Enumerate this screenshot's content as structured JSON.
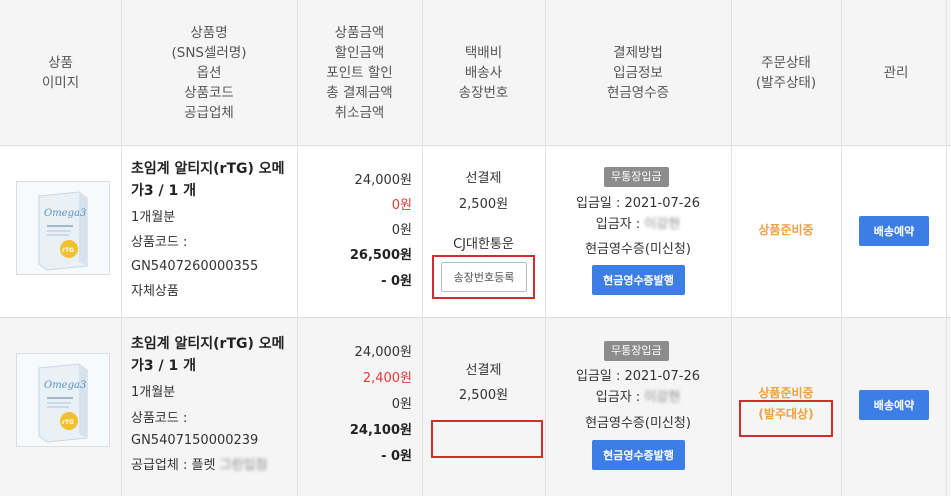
{
  "header": {
    "image": [
      "상품",
      "이미지"
    ],
    "product": [
      "상품명",
      "(SNS셀러명)",
      "옵션",
      "상품코드",
      "공급업체"
    ],
    "amount": [
      "상품금액",
      "할인금액",
      "포인트 할인",
      "총 결제금액",
      "취소금액"
    ],
    "delivery": [
      "택배비",
      "배송사",
      "송장번호"
    ],
    "payment": [
      "결제방법",
      "입금정보",
      "현금영수증"
    ],
    "status": [
      "주문상태",
      "(발주상태)"
    ],
    "manage": [
      "관리"
    ]
  },
  "rows": [
    {
      "name_line1": "초임계 알티지(rTG) 오메",
      "name_line2": "가3 / 1 개",
      "option": "1개월분",
      "code_label": "상품코드 :",
      "code": "GN5407260000355",
      "supplier": "자체상품",
      "price": "24,000원",
      "discount": "0원",
      "point_discount": "0원",
      "total": "26,500원",
      "cancel": "- 0원",
      "shipping_type": "선결제",
      "shipping_fee": "2,500원",
      "carrier": "CJ대한통운",
      "invoice_button": "송장번호등록",
      "pay_badge": "무통장입금",
      "deposit_date": "입금일 : 2021-07-26",
      "depositor_label": "입금자 :",
      "depositor_blur": "이강현",
      "receipt_status": "현금영수증(미신청)",
      "receipt_button": "현금영수증발행",
      "status": "상품준비중",
      "manage_button": "배송예약"
    },
    {
      "name_line1": "초임계 알티지(rTG) 오메",
      "name_line2": "가3 / 1 개",
      "option": "1개월분",
      "code_label": "상품코드 :",
      "code": "GN5407150000239",
      "supplier_label": "공급업체 : 플렛",
      "supplier_blur": "그린입점",
      "price": "24,000원",
      "discount": "2,400원",
      "point_discount": "0원",
      "total": "24,100원",
      "cancel": "- 0원",
      "shipping_type": "선결제",
      "shipping_fee": "2,500원",
      "pay_badge": "무통장입금",
      "deposit_date": "입금일 : 2021-07-26",
      "depositor_label": "입금자 :",
      "depositor_blur": "이강현",
      "receipt_status": "현금영수증(미신청)",
      "receipt_button": "현금영수증발행",
      "status": "상품준비중",
      "status_sub": "(발주대상)",
      "manage_button": "배송예약"
    }
  ],
  "colors": {
    "header_bg": "#f5f5f5",
    "accent_blue": "#3d7de6",
    "status_orange": "#f0a03c",
    "discount_red": "#e03a3a",
    "highlight_red": "#d42b2b",
    "badge_gray": "#8c8c8c"
  },
  "product_image": {
    "brand": "Omega3",
    "label": "rTG"
  }
}
